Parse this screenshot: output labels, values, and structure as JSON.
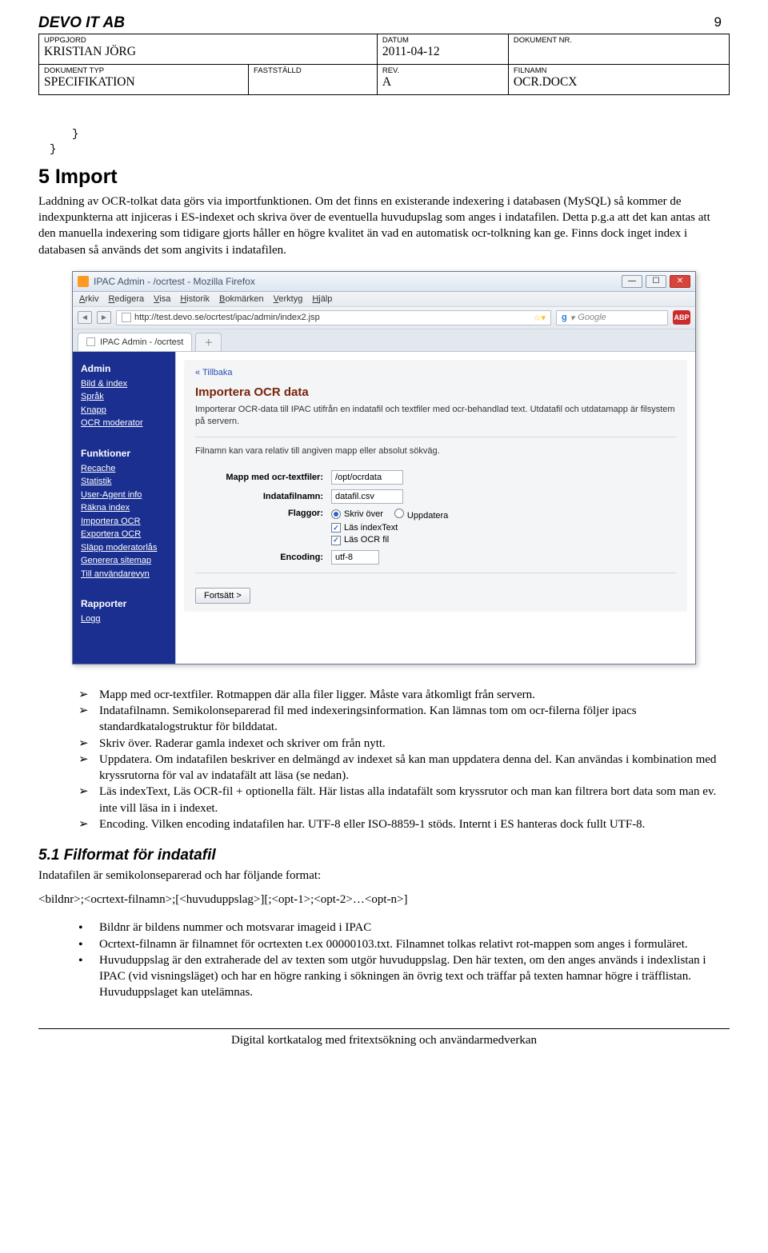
{
  "header": {
    "company": "DEVO IT AB",
    "page_number": "9",
    "labels": {
      "uppgjord": "UPPGJORD",
      "datum": "DATUM",
      "dokument_nr": "DOKUMENT NR.",
      "dokument_typ": "DOKUMENT TYP",
      "faststalld": "FASTSTÄLLD",
      "rev": "REV.",
      "filnamn": "FILNAMN"
    },
    "values": {
      "uppgjord": "KRISTIAN JÖRG",
      "datum": "2011-04-12",
      "dokument_nr": "",
      "dokument_typ": "SPECIFIKATION",
      "faststalld": "",
      "rev": "A",
      "filnamn": "OCR.DOCX"
    }
  },
  "braces": {
    "line1": "}",
    "line2": "}"
  },
  "section5": {
    "title": "5 Import",
    "para": "Laddning av OCR-tolkat data görs via importfunktionen. Om det finns en existerande indexering i databasen (MySQL) så kommer de indexpunkterna att injiceras i ES-indexet och skriva över de eventuella huvudupslag som anges i indatafilen. Detta p.g.a att det kan antas att den manuella indexering som tidigare gjorts håller en högre kvalitet än vad en automatisk ocr-tolkning kan ge. Finns dock inget index i databasen så används det som angivits i indatafilen."
  },
  "screenshot": {
    "window_title": "IPAC Admin - /ocrtest - Mozilla Firefox",
    "menu": [
      "Arkiv",
      "Redigera",
      "Visa",
      "Historik",
      "Bokmärken",
      "Verktyg",
      "Hjälp"
    ],
    "url": "http://test.devo.se/ocrtest/ipac/admin/index2.jsp",
    "search_placeholder": "Google",
    "abp": "ABP",
    "tab_label": "IPAC Admin - /ocrtest",
    "sidebar": {
      "admin_head": "Admin",
      "admin_items": [
        "Bild & index",
        "Språk",
        "Knapp",
        "OCR moderator"
      ],
      "funk_head": "Funktioner",
      "funk_items": [
        "Recache",
        "Statistik",
        "User-Agent info",
        "Räkna index",
        "Importera OCR",
        "Exportera OCR",
        "Släpp moderatorlås",
        "Generera sitemap",
        "Till användarevyn"
      ],
      "rapp_head": "Rapporter",
      "rapp_items": [
        "Logg"
      ]
    },
    "panel": {
      "back": "« Tillbaka",
      "title": "Importera OCR data",
      "desc1": "Importerar OCR-data till IPAC utifrån en indatafil och textfiler med ocr-behandlad text. Utdatafil och utdatamapp är filsystem på servern.",
      "desc2": "Filnamn kan vara relativ till angiven mapp eller absolut sökväg.",
      "labels": {
        "mapp": "Mapp med ocr-textfiler:",
        "indata": "Indatafilnamn:",
        "flaggor": "Flaggor:",
        "encoding": "Encoding:"
      },
      "values": {
        "mapp": "/opt/ocrdata",
        "indata": "datafil.csv",
        "encoding": "utf-8"
      },
      "flags": {
        "skriv_over": "Skriv över",
        "uppdatera": "Uppdatera",
        "las_index": "Läs indexText",
        "las_ocr": "Läs OCR fil"
      },
      "button": "Fortsätt >"
    }
  },
  "arrow_list": [
    "Mapp med ocr-textfiler. Rotmappen där alla filer ligger. Måste vara åtkomligt från servern.",
    "Indatafilnamn. Semikolonseparerad fil med indexeringsinformation. Kan lämnas tom om ocr-filerna följer ipacs standardkatalogstruktur för bilddatat.",
    "Skriv över. Raderar gamla indexet och skriver om från nytt.",
    "Uppdatera. Om indatafilen beskriver en delmängd av indexet så kan man uppdatera denna del. Kan användas i kombination med kryssrutorna för val av indatafält att läsa (se nedan).",
    "Läs indexText, Läs OCR-fil + optionella fält. Här listas alla indatafält som kryssrutor och man kan filtrera bort data som man ev. inte vill läsa in i indexet.",
    "Encoding. Vilken encoding indatafilen har. UTF-8 eller ISO-8859-1 stöds. Internt i ES hanteras dock fullt UTF-8."
  ],
  "section5_1": {
    "title": "5.1 Filformat för indatafil",
    "intro": "Indatafilen är semikolonseparerad och har följande format:",
    "format": "<bildnr>;<ocrtext-filnamn>;[<huvuduppslag>][;<opt-1>;<opt-2>…<opt-n>]",
    "bullets": [
      "Bildnr är bildens nummer och motsvarar imageid i IPAC",
      "Ocrtext-filnamn är filnamnet för ocrtexten t.ex 00000103.txt. Filnamnet tolkas relativt rot-mappen som anges i formuläret.",
      "Huvuduppslag är den extraherade del av texten som utgör huvuduppslag. Den här texten, om den anges används i indexlistan i IPAC (vid visningsläget) och har en högre ranking i sökningen än övrig text och träffar på texten hamnar högre i träfflistan. Huvuduppslaget kan utelämnas."
    ]
  },
  "footer": "Digital kortkatalog med fritextsökning och användarmedverkan"
}
